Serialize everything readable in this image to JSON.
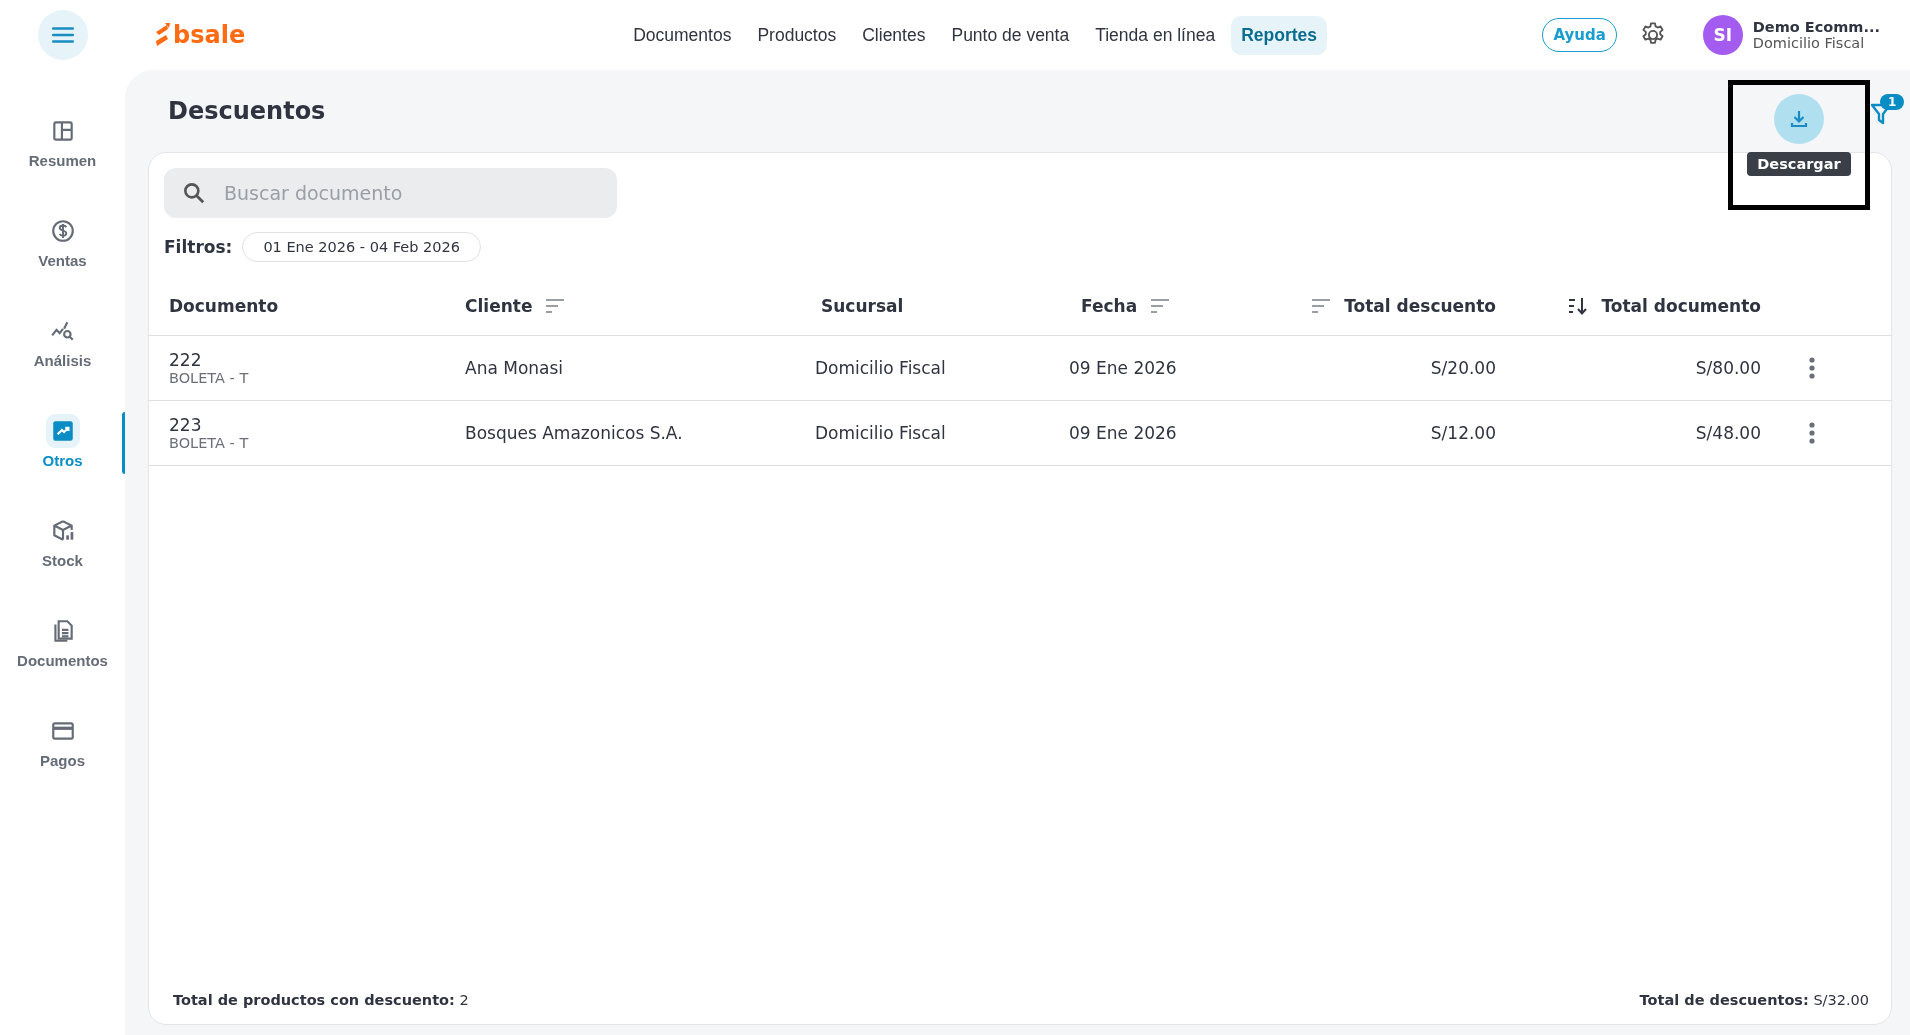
{
  "logo": {
    "text": "bsale"
  },
  "nav": [
    {
      "label": "Documentos",
      "selected": false
    },
    {
      "label": "Productos",
      "selected": false
    },
    {
      "label": "Clientes",
      "selected": false
    },
    {
      "label": "Punto de venta",
      "selected": false
    },
    {
      "label": "Tienda en línea",
      "selected": false
    },
    {
      "label": "Reportes",
      "selected": true
    }
  ],
  "help_button": "Ayuda",
  "user": {
    "initials": "SI",
    "name": "Demo Ecomm...",
    "branch": "Domicilio Fiscal"
  },
  "sidebar": {
    "items": [
      {
        "label": "Resumen",
        "selected": false
      },
      {
        "label": "Ventas",
        "selected": false
      },
      {
        "label": "Análisis",
        "selected": false
      },
      {
        "label": "Otros",
        "selected": true
      },
      {
        "label": "Stock",
        "selected": false
      },
      {
        "label": "Documentos",
        "selected": false
      },
      {
        "label": "Pagos",
        "selected": false
      }
    ]
  },
  "page_title": "Descuentos",
  "download": {
    "tooltip": "Descargar",
    "highlighted": true
  },
  "filter_badge": "1",
  "search": {
    "placeholder": "Buscar documento"
  },
  "filters": {
    "label": "Filtros:",
    "chips": [
      "01 Ene 2026 - 04 Feb 2026"
    ]
  },
  "table": {
    "columns": [
      {
        "label": "Documento",
        "kind": "text",
        "sortable": false
      },
      {
        "label": "Cliente",
        "kind": "text",
        "sortable": true,
        "sorted": false
      },
      {
        "label": "Sucursal",
        "kind": "text",
        "sortable": false
      },
      {
        "label": "Fecha",
        "kind": "text",
        "sortable": true,
        "sorted": false
      },
      {
        "label": "Total descuento",
        "kind": "money",
        "sortable": true,
        "sorted": false
      },
      {
        "label": "Total documento",
        "kind": "money",
        "sortable": true,
        "sorted": true
      }
    ],
    "rows": [
      {
        "cells": [
          {
            "number": "222",
            "type": "BOLETA - T"
          },
          "Ana Monasi",
          "Domicilio Fiscal",
          "09 Ene 2026",
          "S/20.00",
          "S/80.00"
        ]
      },
      {
        "cells": [
          {
            "number": "223",
            "type": "BOLETA - T"
          },
          "Bosques Amazonicos S.A.",
          "Domicilio Fiscal",
          "09 Ene 2026",
          "S/12.00",
          "S/48.00"
        ]
      }
    ]
  },
  "footer": {
    "left": "**Total de productos con descuento:** 2",
    "right": "**Total de descuentos:** S/32.00"
  }
}
